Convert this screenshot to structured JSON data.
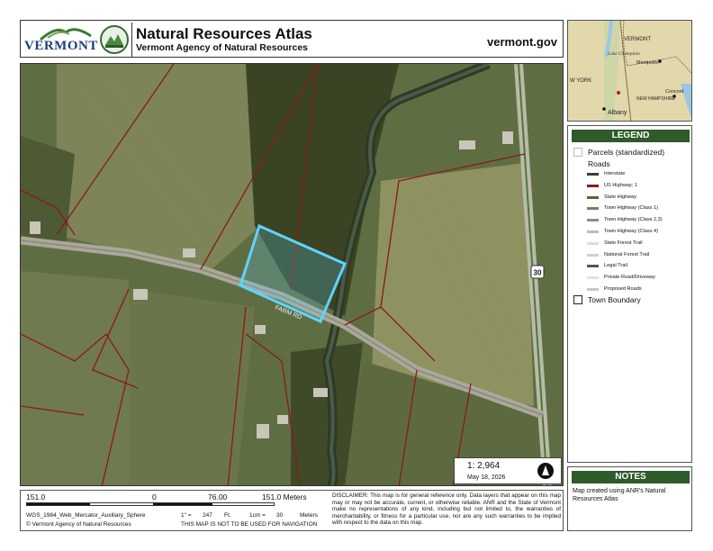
{
  "header": {
    "logo_text": "VERMONT",
    "title": "Natural Resources Atlas",
    "subtitle": "Vermont Agency of Natural Resources",
    "site": "vermont.gov"
  },
  "map": {
    "road_shield": "30",
    "road_label": "FARM RD",
    "scale_label": "1:  2,964",
    "date": "May 18, 2026"
  },
  "inset": {
    "labels": [
      "VERMONT",
      "Lake Champlain",
      "Montpelier",
      "W YORK",
      "Albany",
      "NEW HAMPSHIRE",
      "Concord"
    ]
  },
  "legend": {
    "title": "LEGEND",
    "parcels": "Parcels (standardized)",
    "roads": "Roads",
    "road_items": [
      {
        "label": "Interstate",
        "color": "#3a3a3a"
      },
      {
        "label": "US Highway; 1",
        "color": "#8a1c1c"
      },
      {
        "label": "State Highway",
        "color": "#4f6b2a"
      },
      {
        "label": "Town Highway (Class 1)",
        "color": "#7a7a7a"
      },
      {
        "label": "Town Highway (Class 2,3)",
        "color": "#8d8d8d"
      },
      {
        "label": "Town Highway (Class 4)",
        "color": "#bdbdbd"
      },
      {
        "label": "State Forest Trail",
        "color": "#dddddd"
      },
      {
        "label": "National Forest Trail",
        "color": "#cfcfcf"
      },
      {
        "label": "Legal Trail",
        "color": "#555555"
      },
      {
        "label": "Private Road/Driveway",
        "color": "#e2e2e2"
      },
      {
        "label": "Proposed Roads",
        "color": "#c8c8c8"
      }
    ],
    "town_boundary": "Town Boundary"
  },
  "notes": {
    "title": "NOTES",
    "text": "Map created using ANR's Natural Resources Atlas"
  },
  "footer": {
    "scale_left": "151.0",
    "scale_zero": "0",
    "scale_mid": "76.00",
    "scale_right": "151.0 Meters",
    "projection": "WGS_1984_Web_Mercator_Auxiliary_Sphere",
    "copyright": "© Vermont Agency of Natural Resources",
    "ratio_1": "1\" =",
    "ratio_2": "247",
    "ratio_3": "Ft.",
    "ratio_4": "1cm =",
    "ratio_5": "30",
    "ratio_6": "Meters",
    "nav_warning": "THIS MAP IS NOT TO BE USED FOR NAVIGATION",
    "disclaimer": "DISCLAIMER: This map is for general reference only. Data layers that appear on this map may or may not be accurate, current, or otherwise reliable. ANR and the State of Vermont make no representations of any kind, including but not limited to, the warranties of merchantability, or fitness for a particular use, nor are any such warranties to be implied with respect to the data on this map."
  },
  "colors": {
    "legend_header": "#2f5a2a",
    "parcel_line": "#8b1a1a",
    "selection": "#5fd4ff"
  }
}
